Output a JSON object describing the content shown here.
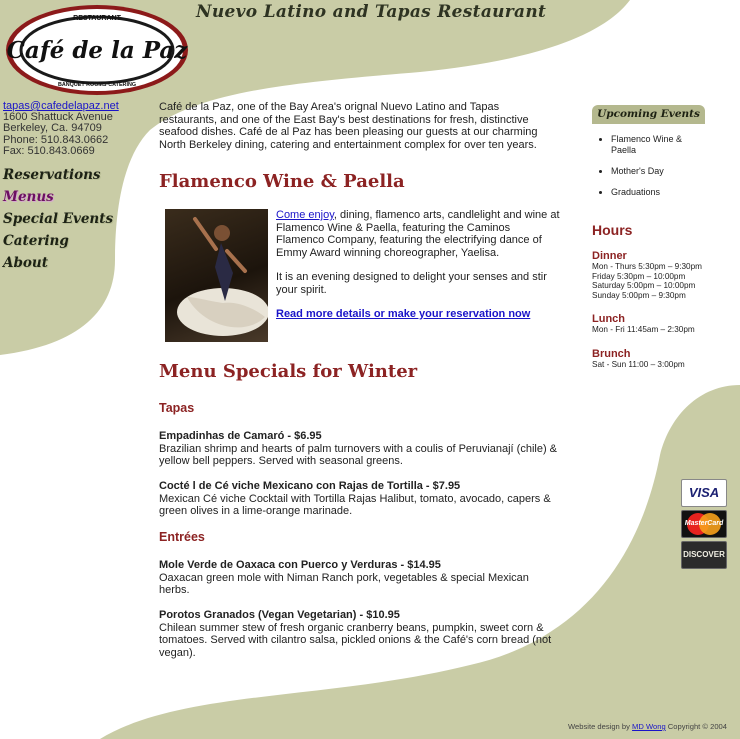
{
  "header": {
    "logo_top": "RESTAURANT",
    "logo_name": "Café de la Paz",
    "logo_bottom": "BANQUET ROOMS·CATERING",
    "tagline": "Nuevo Latino and Tapas Restaurant"
  },
  "contact": {
    "email": "tapas@cafedelapaz.net",
    "address": "1600 Shattuck Avenue",
    "city": "Berkeley, Ca. 94709",
    "phone": "Phone: 510.843.0662",
    "fax": "Fax: 510.843.0669"
  },
  "nav": {
    "items": [
      "Reservations",
      "Menus",
      "Special Events",
      "Catering",
      "About"
    ],
    "active": "Menus"
  },
  "main": {
    "intro": "Café de la Paz, one of the Bay Area's orignal Nuevo Latino and Tapas restaurants, and one of the East Bay's best destinations for fresh, distinctive seafood dishes. Café de al Paz has been pleasing our guests at our charming North Berkeley dining, catering and entertainment complex for over ten years.",
    "flamenco_heading": "Flamenco Wine & Paella",
    "feature_link": "Come enjoy",
    "feature_text": ", dining, flamenco arts, candlelight and wine at Flamenco Wine & Paella, featuring the Caminos Flamenco Company, featuring the electrifying dance of Emmy Award winning choreographer, Yaelisa.",
    "feature_text2": "It is an evening designed to delight your senses and stir your spirit.",
    "feature_cta": "Read more details or make your reservation now",
    "menu_heading": "Menu Specials for Winter",
    "tapas_heading": "Tapas",
    "entrees_heading": "Entrées",
    "dishes": [
      {
        "name": "Empadinhas de Camaró - $6.95",
        "desc": "Brazilian shrimp and hearts of palm turnovers with a coulis of Peruvianají (chile) & yellow bell peppers. Served with seasonal greens."
      },
      {
        "name": "Cocté l de Cé viche Mexicano con Rajas de Tortilla - $7.95",
        "desc": "Mexican Cé viche Cocktail with Tortilla Rajas Halibut, tomato, avocado, capers & green olives in a lime-orange marinade."
      },
      {
        "name": "Mole Verde de Oaxaca con Puerco y Verduras - $14.95",
        "desc": "Oaxacan green mole with Niman Ranch pork, vegetables & special Mexican herbs."
      },
      {
        "name": "Porotos Granados (Vegan Vegetarian) - $10.95",
        "desc": "Chilean summer stew of fresh organic cranberry beans, pumpkin, sweet corn & tomatoes. Served with cilantro salsa, pickled onions & the Café's corn bread (not vegan)."
      }
    ]
  },
  "events": {
    "title": "Upcoming Events",
    "items": [
      "Flamenco Wine & Paella",
      "Mother's Day",
      "Graduations"
    ]
  },
  "hours": {
    "title": "Hours",
    "dinner": "Dinner",
    "dinner_lines": [
      "Mon - Thurs 5:30pm – 9:30pm",
      "Friday 5:30pm – 10:00pm",
      "Saturday 5:00pm – 10:00pm",
      "Sunday 5:00pm – 9:30pm"
    ],
    "lunch": "Lunch",
    "lunch_lines": [
      "Mon - Fri 11:45am – 2:30pm"
    ],
    "brunch": "Brunch",
    "brunch_lines": [
      "Sat - Sun 11:00 – 3:00pm"
    ]
  },
  "cards": [
    "VISA",
    "MasterCard",
    "DISCOVER"
  ],
  "footer": {
    "prefix": "Website design by",
    "designer": "MD Wong",
    "suffix": "Copyright © 2004"
  },
  "colors": {
    "olive_background": "#c9cca6",
    "heading_red": "#8c2323",
    "link_blue": "#1a14c8",
    "active_nav_purple": "#6c0f62"
  }
}
